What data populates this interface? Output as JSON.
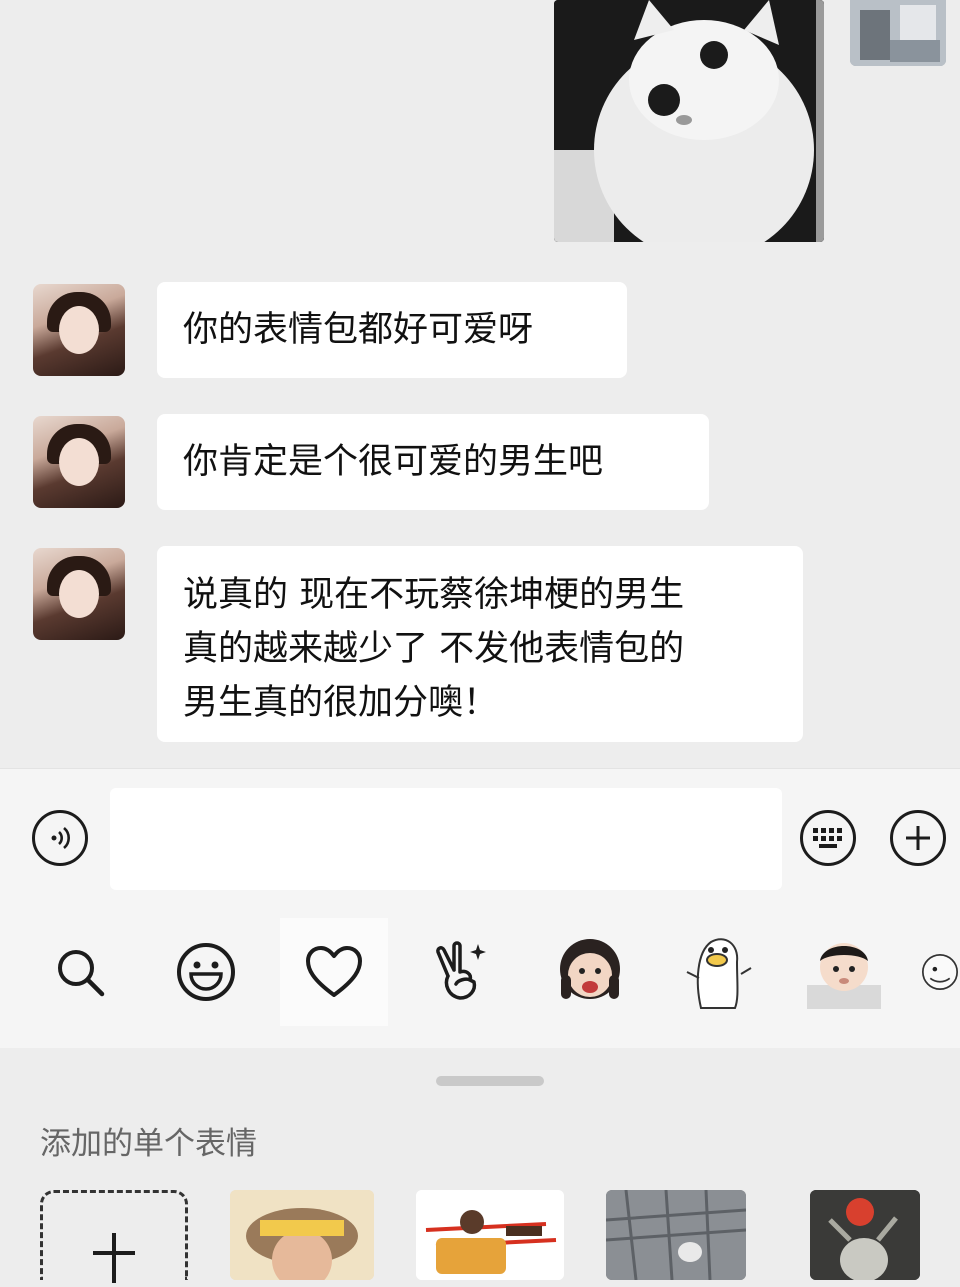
{
  "chat": {
    "messages": [
      {
        "text": "你的表情包都好可爱呀"
      },
      {
        "text": "你肯定是个很可爱的男生吧"
      },
      {
        "lines": [
          "说真的 现在不玩蔡徐坤梗的男生",
          "真的越来越少了 不发他表情包的",
          "男生真的很加分噢！"
        ]
      }
    ]
  },
  "input_bar": {
    "voice_icon": "voice-icon",
    "keyboard_icon": "keyboard-icon",
    "more_icon": "plus-circle-icon",
    "text": ""
  },
  "emoji_tabs": {
    "icons": [
      "search-icon",
      "smiley-icon",
      "heart-icon",
      "victory-hand-icon",
      "sticker-girl",
      "sticker-duck",
      "sticker-baby",
      "sticker-cartoon"
    ],
    "selected": "heart-icon"
  },
  "panel": {
    "section_title": "添加的单个表情",
    "add_icon": "plus-icon"
  }
}
